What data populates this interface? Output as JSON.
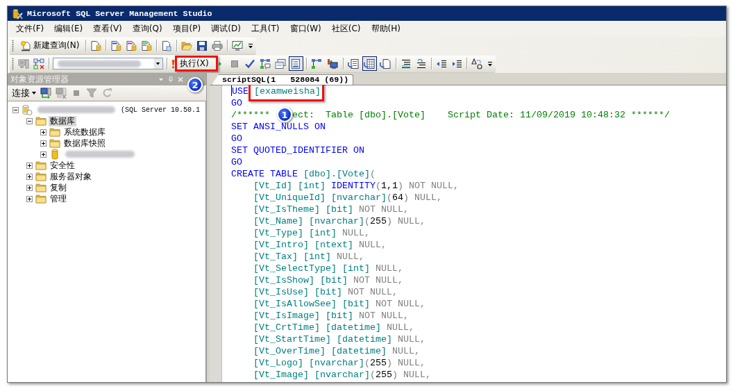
{
  "window": {
    "title": "Microsoft SQL Server Management Studio"
  },
  "menu": [
    "文件(F)",
    "编辑(E)",
    "查看(V)",
    "查询(Q)",
    "项目(P)",
    "调试(D)",
    "工具(T)",
    "窗口(W)",
    "社区(C)",
    "帮助(H)"
  ],
  "toolbar": {
    "new_query": {
      "label": "新建查询(N)",
      "highlighted": false
    },
    "execute": {
      "label": "执行(X)",
      "highlighted": true
    },
    "toggles": [
      {
        "on": true
      },
      {
        "on": false
      },
      {
        "on": false
      },
      {
        "on": false
      },
      {
        "on": true
      },
      {
        "on": false
      }
    ]
  },
  "object_explorer": {
    "title": "对象资源管理器",
    "badge": "2",
    "connect": "连接",
    "tools": [
      {
        "disabled": false
      },
      {
        "disabled": true
      },
      {
        "disabled": true
      },
      {
        "disabled": true
      },
      {
        "disabled": true
      }
    ],
    "tree": [
      {
        "kind": "server",
        "label": "(SQL Server 10.50.1",
        "expanded": true,
        "selected": false,
        "children": [
          {
            "kind": "folder",
            "label": "数据库",
            "expanded": true,
            "selected": true,
            "children": [
              {
                "kind": "folder",
                "label": "系统数据库",
                "expanded": false,
                "selected": false
              },
              {
                "kind": "folder",
                "label": "数据库快照",
                "expanded": false,
                "selected": false
              },
              {
                "kind": "database",
                "expanded": false,
                "selected": false
              }
            ]
          },
          {
            "kind": "folder",
            "label": "安全性",
            "expanded": false,
            "selected": false
          },
          {
            "kind": "folder",
            "label": "服务器对象",
            "expanded": false,
            "selected": false
          },
          {
            "kind": "folder",
            "label": "复制",
            "expanded": false,
            "selected": false
          },
          {
            "kind": "folder",
            "label": "管理",
            "expanded": false,
            "selected": false
          }
        ]
      }
    ]
  },
  "editor": {
    "tabs": [
      {
        "label": "scriptSQL(1   528084 (69))",
        "selected": true
      }
    ],
    "lines": [
      {
        "segments": [
          {
            "kind": "keyword",
            "text": "USE"
          },
          {
            "kind": "boxed",
            "text": "[examweisha]"
          }
        ]
      },
      {
        "segments": [
          {
            "kind": "keyword",
            "text": "GO"
          }
        ]
      },
      {
        "segments": [
          {
            "kind": "comment",
            "text": "/******"
          },
          {
            "kind": "badge",
            "text": "1"
          },
          {
            "kind": "comment",
            "text": "ect:  Table [dbo].[Vote]    Script Date: 11/09/2019 10:48:32 ******/"
          }
        ]
      },
      {
        "segments": [
          {
            "kind": "keyword",
            "text": "SET ANSI_NULLS ON"
          }
        ]
      },
      {
        "segments": [
          {
            "kind": "keyword",
            "text": "GO"
          }
        ]
      },
      {
        "segments": [
          {
            "kind": "keyword",
            "text": "SET QUOTED_IDENTIFIER ON"
          }
        ]
      },
      {
        "segments": [
          {
            "kind": "keyword",
            "text": "GO"
          }
        ]
      },
      {
        "segments": [
          {
            "kind": "keyword",
            "text": "CREATE TABLE "
          },
          {
            "kind": "name",
            "text": "[dbo].[Vote]"
          },
          {
            "kind": "gray",
            "text": "("
          }
        ],
        "children": [
          {
            "segments": [
              {
                "kind": "name",
                "text": "[Vt_Id] [int] "
              },
              {
                "kind": "keyword",
                "text": "IDENTITY"
              },
              {
                "kind": "gray",
                "text": "("
              },
              {
                "kind": "number",
                "text": "1,1"
              },
              {
                "kind": "gray",
                "text": ") NOT NULL,"
              }
            ]
          },
          {
            "segments": [
              {
                "kind": "name",
                "text": "[Vt_UniqueId] [nvarchar]"
              },
              {
                "kind": "gray",
                "text": "("
              },
              {
                "kind": "number",
                "text": "64"
              },
              {
                "kind": "gray",
                "text": ") NULL,"
              }
            ]
          },
          {
            "segments": [
              {
                "kind": "name",
                "text": "[Vt_IsTheme] [bit] "
              },
              {
                "kind": "gray",
                "text": "NOT NULL,"
              }
            ]
          },
          {
            "segments": [
              {
                "kind": "name",
                "text": "[Vt_Name] [nvarchar]"
              },
              {
                "kind": "gray",
                "text": "("
              },
              {
                "kind": "number",
                "text": "255"
              },
              {
                "kind": "gray",
                "text": ") NULL,"
              }
            ]
          },
          {
            "segments": [
              {
                "kind": "name",
                "text": "[Vt_Type] [int] "
              },
              {
                "kind": "gray",
                "text": "NULL,"
              }
            ]
          },
          {
            "segments": [
              {
                "kind": "name",
                "text": "[Vt_Intro] [ntext] "
              },
              {
                "kind": "gray",
                "text": "NULL,"
              }
            ]
          },
          {
            "segments": [
              {
                "kind": "name",
                "text": "[Vt_Tax] [int] "
              },
              {
                "kind": "gray",
                "text": "NULL,"
              }
            ]
          },
          {
            "segments": [
              {
                "kind": "name",
                "text": "[Vt_SelectType] [int] "
              },
              {
                "kind": "gray",
                "text": "NULL,"
              }
            ]
          },
          {
            "segments": [
              {
                "kind": "name",
                "text": "[Vt_IsShow] [bit] "
              },
              {
                "kind": "gray",
                "text": "NOT NULL,"
              }
            ]
          },
          {
            "segments": [
              {
                "kind": "name",
                "text": "[Vt_IsUse] [bit] "
              },
              {
                "kind": "gray",
                "text": "NOT NULL,"
              }
            ]
          },
          {
            "segments": [
              {
                "kind": "name",
                "text": "[Vt_IsAllowSee] [bit] "
              },
              {
                "kind": "gray",
                "text": "NOT NULL,"
              }
            ]
          },
          {
            "segments": [
              {
                "kind": "name",
                "text": "[Vt_IsImage] [bit] "
              },
              {
                "kind": "gray",
                "text": "NOT NULL,"
              }
            ]
          },
          {
            "segments": [
              {
                "kind": "name",
                "text": "[Vt_CrtTime] [datetime] "
              },
              {
                "kind": "gray",
                "text": "NULL,"
              }
            ]
          },
          {
            "segments": [
              {
                "kind": "name",
                "text": "[Vt_StartTime] [datetime] "
              },
              {
                "kind": "gray",
                "text": "NULL,"
              }
            ]
          },
          {
            "segments": [
              {
                "kind": "name",
                "text": "[Vt_OverTime] [datetime] "
              },
              {
                "kind": "gray",
                "text": "NULL,"
              }
            ]
          },
          {
            "segments": [
              {
                "kind": "name",
                "text": "[Vt_Logo] [nvarchar]"
              },
              {
                "kind": "gray",
                "text": "("
              },
              {
                "kind": "number",
                "text": "255"
              },
              {
                "kind": "gray",
                "text": ") NULL,"
              }
            ]
          },
          {
            "segments": [
              {
                "kind": "name",
                "text": "[Vt_Image] [nvarchar]"
              },
              {
                "kind": "gray",
                "text": "("
              },
              {
                "kind": "number",
                "text": "255"
              },
              {
                "kind": "gray",
                "text": ") NULL,"
              }
            ]
          }
        ]
      }
    ]
  }
}
